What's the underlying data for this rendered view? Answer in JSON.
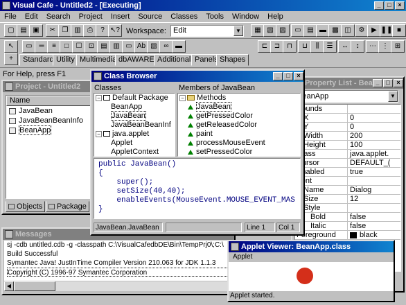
{
  "app": {
    "title": "Visual Cafe - Untitled2 - [Executing]"
  },
  "menu": [
    "File",
    "Edit",
    "Search",
    "Project",
    "Insert",
    "Source",
    "Classes",
    "Tools",
    "Window",
    "Help"
  ],
  "toolbar": {
    "workspace_label": "Workspace:",
    "workspace_value": "Edit"
  },
  "palette_tabs": [
    "Standard",
    "Utility",
    "Multimedia",
    "dbAWARE",
    "Additional",
    "Panels",
    "Shapes"
  ],
  "status": "For Help, press F1",
  "project": {
    "title": "Project - Untitled2",
    "column": "Name",
    "items": [
      "JavaBean",
      "JavaBeanBeanInfo",
      "BeanApp"
    ],
    "tabs": [
      "Objects",
      "Package"
    ]
  },
  "class_browser": {
    "title": "Class Browser",
    "classes_header": "Classes",
    "members_header": "Members of JavaBean",
    "classes": [
      "Default Package",
      "BeanApp",
      "JavaBean",
      "JavaBeanBeanInf",
      "java.applet",
      "Applet",
      "AppletContext"
    ],
    "members": [
      "Methods",
      "JavaBean",
      "getPressedColor",
      "getReleasedColor",
      "paint",
      "processMouseEvent",
      "setPressedColor"
    ],
    "code": [
      "public JavaBean()",
      "{",
      "    super();",
      "    setSize(40,40);",
      "    enableEvents(MouseEvent.MOUSE_EVENT_MAS",
      "}"
    ],
    "status_file": "JavaBean.JavaBean",
    "status_line": "Line 1",
    "status_col": "Col 1"
  },
  "property_list": {
    "title": "Property List - Bea...",
    "selected": "BeanApp",
    "rows": [
      {
        "k": "Bounds",
        "v": ""
      },
      {
        "k": "X",
        "v": "0"
      },
      {
        "k": "Y",
        "v": "0"
      },
      {
        "k": "Width",
        "v": "200"
      },
      {
        "k": "Height",
        "v": "100"
      },
      {
        "k": "Class",
        "v": "java.applet."
      },
      {
        "k": "Cursor",
        "v": "DEFAULT_("
      },
      {
        "k": "Enabled",
        "v": "true"
      },
      {
        "k": "Font",
        "v": ""
      },
      {
        "k": "Name",
        "v": "Dialog"
      },
      {
        "k": "Size",
        "v": "12"
      },
      {
        "k": "Style",
        "v": ""
      },
      {
        "k": "Bold",
        "v": "false"
      },
      {
        "k": "Italic",
        "v": "false"
      },
      {
        "k": "Foreground",
        "v": "black"
      }
    ]
  },
  "messages": {
    "title": "Messages",
    "lines": [
      "sj -cdb untitled.cdb -g -classpath C:\\VisualCafedbDE\\Bin\\TempPrj0\\;C:\\",
      "Build Successful",
      "Symantec Java! JustInTime Compiler Version 210.063 for JDK 1.1.3",
      "Copyright (C) 1996-97 Symantec Corporation"
    ]
  },
  "applet_viewer": {
    "title": "Applet Viewer: BeanApp.class",
    "menu": "Applet",
    "status": "Applet started.",
    "circle_color": "#d42f1a"
  }
}
